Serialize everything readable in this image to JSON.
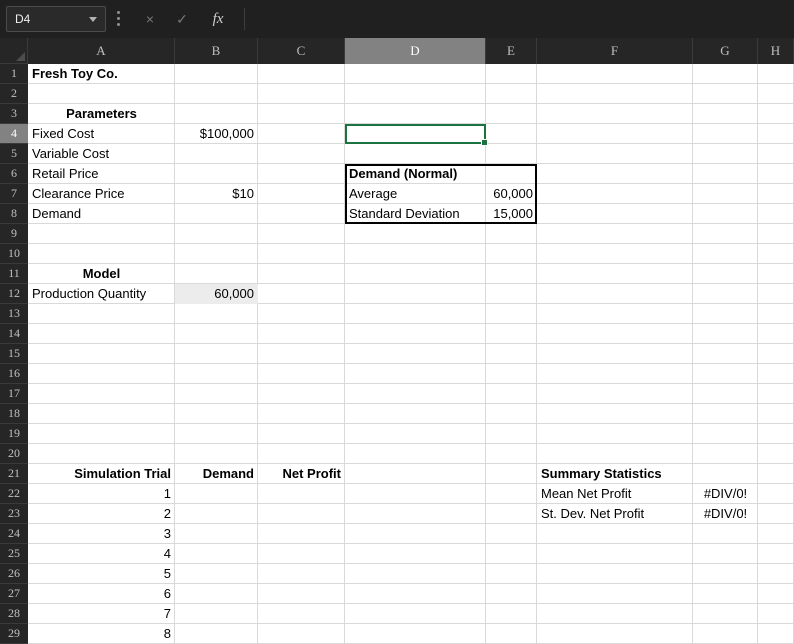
{
  "formula_bar": {
    "name_box_value": "D4",
    "cancel_glyph": "×",
    "enter_glyph": "✓",
    "fx_label": "fx",
    "formula_value": ""
  },
  "sheet": {
    "columns": [
      "A",
      "B",
      "C",
      "D",
      "E",
      "F",
      "G",
      "H"
    ],
    "row_count": 29,
    "selected_column": "D",
    "selected_row": 4,
    "active_cell": "D4",
    "boxed_range": "D6:E8",
    "cells": [
      {
        "ref": "A1",
        "text": "Fresh Toy Co.",
        "bold": true
      },
      {
        "ref": "A3",
        "text": "Parameters",
        "bold": true,
        "align": "center"
      },
      {
        "ref": "A4",
        "text": "Fixed Cost"
      },
      {
        "ref": "B4",
        "text": "$100,000",
        "align": "right"
      },
      {
        "ref": "A5",
        "text": "Variable Cost"
      },
      {
        "ref": "A6",
        "text": "Retail Price"
      },
      {
        "ref": "D6",
        "text": "Demand (Normal)",
        "bold": true
      },
      {
        "ref": "A7",
        "text": "Clearance Price"
      },
      {
        "ref": "B7",
        "text": "$10",
        "align": "right"
      },
      {
        "ref": "D7",
        "text": "Average"
      },
      {
        "ref": "E7",
        "text": "60,000",
        "align": "right"
      },
      {
        "ref": "A8",
        "text": "Demand"
      },
      {
        "ref": "D8",
        "text": "Standard Deviation"
      },
      {
        "ref": "E8",
        "text": "15,000",
        "align": "right"
      },
      {
        "ref": "A11",
        "text": "Model",
        "bold": true,
        "align": "center"
      },
      {
        "ref": "A12",
        "text": "Production Quantity"
      },
      {
        "ref": "B12",
        "text": "60,000",
        "align": "right",
        "fill": true
      },
      {
        "ref": "A21",
        "text": "Simulation Trial",
        "bold": true,
        "align": "right"
      },
      {
        "ref": "B21",
        "text": "Demand",
        "bold": true,
        "align": "right"
      },
      {
        "ref": "C21",
        "text": "Net Profit",
        "bold": true,
        "align": "right"
      },
      {
        "ref": "F21",
        "text": "Summary Statistics",
        "bold": true
      },
      {
        "ref": "A22",
        "text": "1",
        "align": "right"
      },
      {
        "ref": "F22",
        "text": "Mean Net Profit"
      },
      {
        "ref": "G22",
        "text": "#DIV/0!",
        "align": "center"
      },
      {
        "ref": "A23",
        "text": "2",
        "align": "right"
      },
      {
        "ref": "F23",
        "text": "St. Dev. Net Profit"
      },
      {
        "ref": "G23",
        "text": "#DIV/0!",
        "align": "center"
      },
      {
        "ref": "A24",
        "text": "3",
        "align": "right"
      },
      {
        "ref": "A25",
        "text": "4",
        "align": "right"
      },
      {
        "ref": "A26",
        "text": "5",
        "align": "right"
      },
      {
        "ref": "A27",
        "text": "6",
        "align": "right"
      },
      {
        "ref": "A28",
        "text": "7",
        "align": "right"
      },
      {
        "ref": "A29",
        "text": "8",
        "align": "right"
      }
    ]
  },
  "colors": {
    "selection_green": "#1a7340",
    "cell_fill_gray": "#ececec",
    "range_border": "#000000"
  }
}
